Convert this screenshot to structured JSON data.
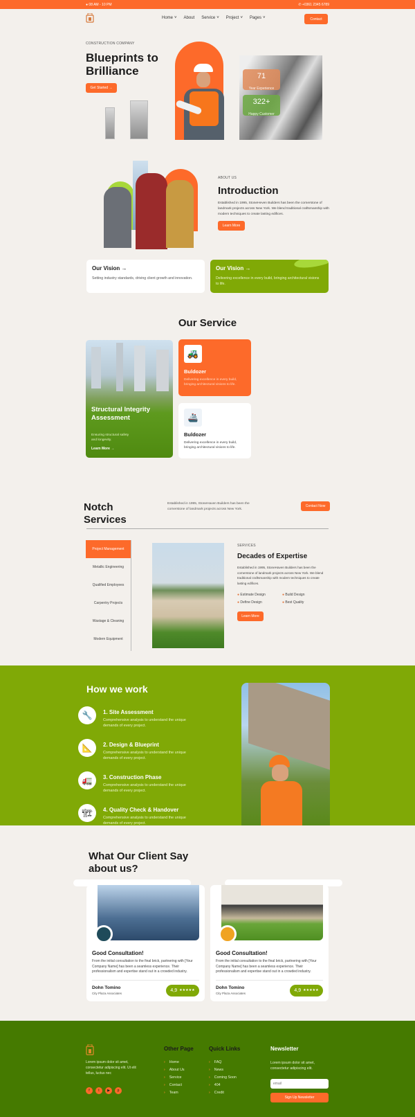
{
  "topbar": {
    "hours": "08 AM - 10 PM",
    "phone": "+0361 2345 6789"
  },
  "nav": {
    "items": [
      "Home",
      "About",
      "Service",
      "Project",
      "Pages"
    ],
    "has_dropdown": [
      true,
      false,
      true,
      true,
      true
    ],
    "contact": "Contact"
  },
  "hero": {
    "eyebrow": "CONSTRUCTION COMPANY",
    "title_line1": "Blueprints to",
    "title_line2": "Brilliance",
    "cta": "Get Started  →",
    "stats": [
      {
        "value": "71",
        "label": "Year Experience"
      },
      {
        "value": "322+",
        "label": "Happy Customer"
      }
    ]
  },
  "about": {
    "eyebrow": "ABOUT US",
    "title": "Introduction",
    "text": "Established in 1995, StoneHeven Builders has been the cornerstone of landmark projects across New York. We blend traditional craftsmanship with modern techniques to create lasting edifices.",
    "cta": "Learn More"
  },
  "vision": [
    {
      "title": "Our Vision →",
      "text": "Setting industry standards, driving client growth and innovation."
    },
    {
      "title": "Our Vision →",
      "text": "Delivering excellence in every build, bringing architectural visions to life."
    }
  ],
  "services": {
    "title": "Our Service",
    "feature": {
      "title": "Structural Integrity Assessment",
      "text": "Ensuring structural safety and longevity.",
      "link": "Learn More →"
    },
    "cards": [
      {
        "title": "Buldozer",
        "text": "Delivering excellence in every build, bringing architectural visions to life."
      },
      {
        "title": "Buldozer",
        "text": "Delivering excellence in every build, bringing architectural visions to life."
      }
    ]
  },
  "notch": {
    "title_line1": "Notch",
    "title_line2": "Services",
    "text": "Established in 1995, StoneHaven Builders has been the cornerstone of landmark projects across New York.",
    "cta": "Contact Now",
    "tabs": [
      "Project Management",
      "Metallic Engineering",
      "Qualified Employees",
      "Carpentry Projects",
      "Wastage & Cleaning",
      "Modern Equipment"
    ],
    "active_tab": 0,
    "detail": {
      "eyebrow": "SERVICES",
      "title": "Decades of Expertise",
      "text": "Established in 1995, StoneHaven Builders has been the cornerstone of landmark projects across New York. We blend traditional craftsmanship with modern techniques to create lasting edifices.",
      "features": [
        "Estimate Design",
        "Build Design",
        "Define Design",
        "Best Quality"
      ],
      "cta": "Learn More"
    }
  },
  "how": {
    "title": "How we work",
    "steps": [
      {
        "title": "1. Site Assessment",
        "text": "Comprehensive analysis to understand the unique demands of every project."
      },
      {
        "title": "2. Design & Blueprint",
        "text": "Comprehensive analysis to understand the unique demands of every project."
      },
      {
        "title": "3. Construction Phase",
        "text": "Comprehensive analysis to understand the unique demands of every project."
      },
      {
        "title": "4. Quality Check & Handover",
        "text": "Comprehensive analysis to understand the unique demands of every project."
      }
    ]
  },
  "testimonials": {
    "title_line1": "What Our Client Say",
    "title_line2": "about us?",
    "items": [
      {
        "title": "Good Consultation!",
        "text": "From the initial consultation to the final brick, partnering with [Your Company Name] has been a seamless experience. Their professionalism and expertise stand out in a crowded industry.",
        "name": "Dohn Tomino",
        "company": "City Plaza Associates",
        "rating": "4,9",
        "stars": "★★★★★"
      },
      {
        "title": "Good Consultation!",
        "text": "From the initial consultation to the final brick, partnering with [Your Company Name] has been a seamless experience. Their professionalism and expertise stand out in a crowded industry.",
        "name": "Dohn Tomino",
        "company": "City Plaza Associates",
        "rating": "4,9",
        "stars": "★★★★★"
      }
    ]
  },
  "footer": {
    "about": "Lorem ipsum dolor sit amet, consectetur adipiscing elit. Ut elit tellus, luctus nec",
    "other_title": "Other Page",
    "other": [
      "Home",
      "About Us",
      "Service",
      "Contact",
      "Team"
    ],
    "quick_title": "Quick Links",
    "quick": [
      "FAQ",
      "News",
      "Coming Soon",
      "404",
      "Credit"
    ],
    "news_title": "Newsletter",
    "news_text": "Lorem ipsum dolor sit amet, consectetur adipiscing elit.",
    "email_placeholder": "email",
    "signup": "Sign Up Newsletter"
  },
  "colors": {
    "accent": "#fd6a2a",
    "green": "#80a906",
    "footer": "#457a00"
  }
}
